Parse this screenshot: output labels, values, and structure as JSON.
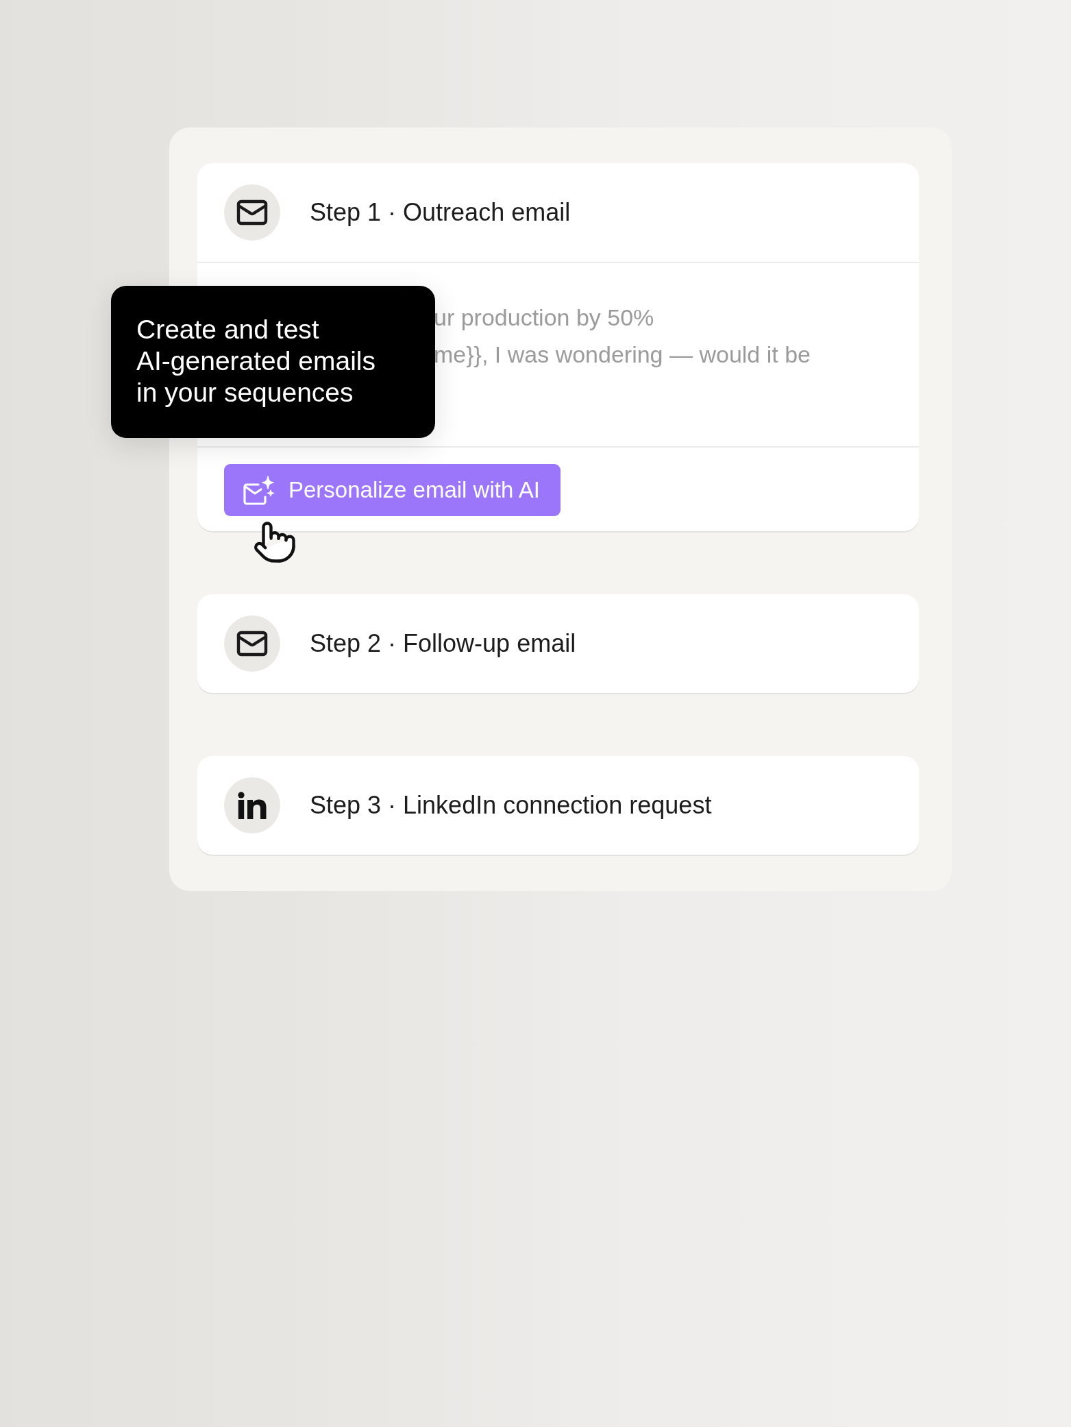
{
  "steps": [
    {
      "kind": "email",
      "label": "Step 1 · Outreach email",
      "expanded": true,
      "subject": "ur production by 50%",
      "body": "me}}, I was wondering — would it be",
      "action": {
        "label": "Personalize email with AI"
      }
    },
    {
      "kind": "email",
      "label": "Step 2 · Follow-up email",
      "expanded": false
    },
    {
      "kind": "linkedin",
      "label": "Step 3 · LinkedIn connection request",
      "expanded": false
    }
  ],
  "tooltip": {
    "lines": [
      "Create and test",
      "AI-generated emails",
      "in your sequences"
    ]
  }
}
